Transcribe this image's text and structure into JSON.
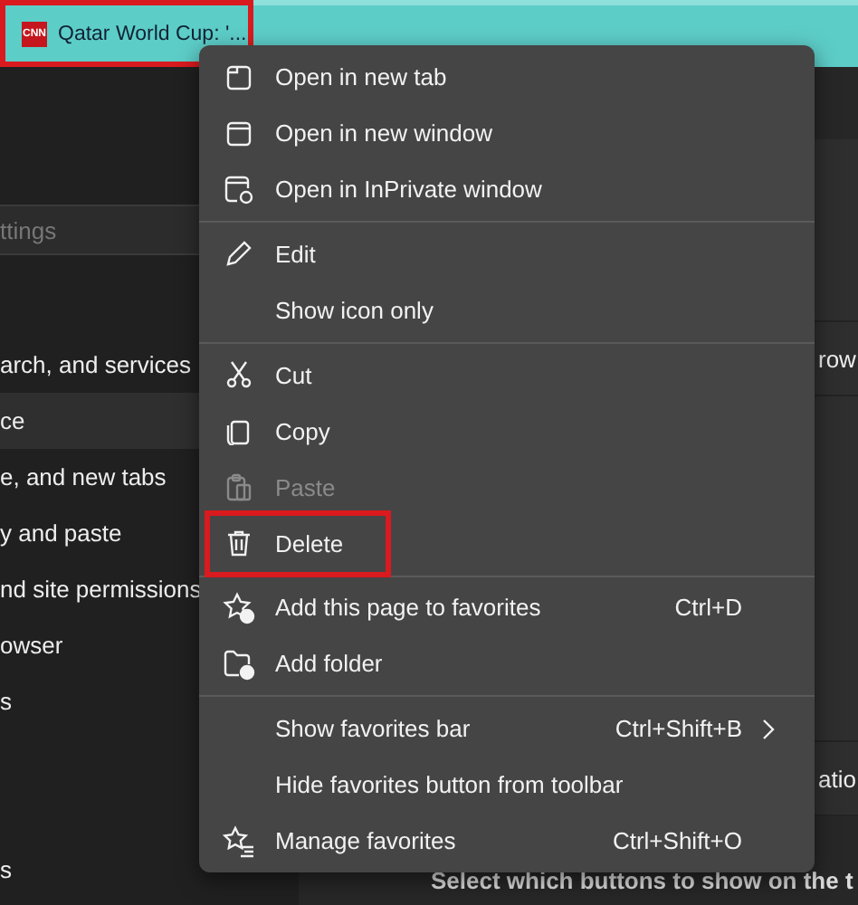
{
  "favorites_bar": {
    "item": {
      "logo": "CNN",
      "label": "Qatar World Cup: '...",
      "highlighted": true
    }
  },
  "settings_sidebar": {
    "search": {
      "placeholder": "ttings"
    },
    "items": [
      {
        "label": "arch, and services",
        "selected": false
      },
      {
        "label": "ce",
        "selected": true
      },
      {
        "label": "e, and new tabs",
        "selected": false
      },
      {
        "label": "y and paste",
        "selected": false
      },
      {
        "label": "nd site permissions",
        "selected": false
      },
      {
        "label": "owser",
        "selected": false
      },
      {
        "label": "s",
        "selected": false
      }
    ],
    "bottom_item": {
      "label": "s",
      "selected": false
    }
  },
  "main": {
    "row_texts": [
      "row",
      "atio"
    ],
    "description": "Select which buttons to show on the t"
  },
  "context_menu": {
    "groups": [
      [
        {
          "label": "Open in new tab",
          "disabled": false,
          "highlighted": false,
          "submenu": false
        },
        {
          "label": "Open in new window",
          "disabled": false,
          "highlighted": false,
          "submenu": false
        },
        {
          "label": "Open in InPrivate window",
          "disabled": false,
          "highlighted": false,
          "submenu": false
        }
      ],
      [
        {
          "label": "Edit",
          "disabled": false,
          "highlighted": false,
          "submenu": false
        },
        {
          "label": "Show icon only",
          "disabled": false,
          "highlighted": false,
          "submenu": false
        }
      ],
      [
        {
          "label": "Cut",
          "disabled": false,
          "highlighted": false,
          "submenu": false
        },
        {
          "label": "Copy",
          "disabled": false,
          "highlighted": false,
          "submenu": false
        },
        {
          "label": "Paste",
          "disabled": true,
          "highlighted": false,
          "submenu": false
        },
        {
          "label": "Delete",
          "disabled": false,
          "highlighted": true,
          "submenu": false
        }
      ],
      [
        {
          "label": "Add this page to favorites",
          "shortcut": "Ctrl+D",
          "disabled": false,
          "highlighted": false,
          "submenu": false
        },
        {
          "label": "Add folder",
          "disabled": false,
          "highlighted": false,
          "submenu": false
        }
      ],
      [
        {
          "label": "Show favorites bar",
          "shortcut": "Ctrl+Shift+B",
          "disabled": false,
          "highlighted": false,
          "submenu": true
        },
        {
          "label": "Hide favorites button from toolbar",
          "disabled": false,
          "highlighted": false,
          "submenu": false
        },
        {
          "label": "Manage favorites",
          "shortcut": "Ctrl+Shift+O",
          "disabled": false,
          "highlighted": false,
          "submenu": false
        }
      ]
    ]
  }
}
